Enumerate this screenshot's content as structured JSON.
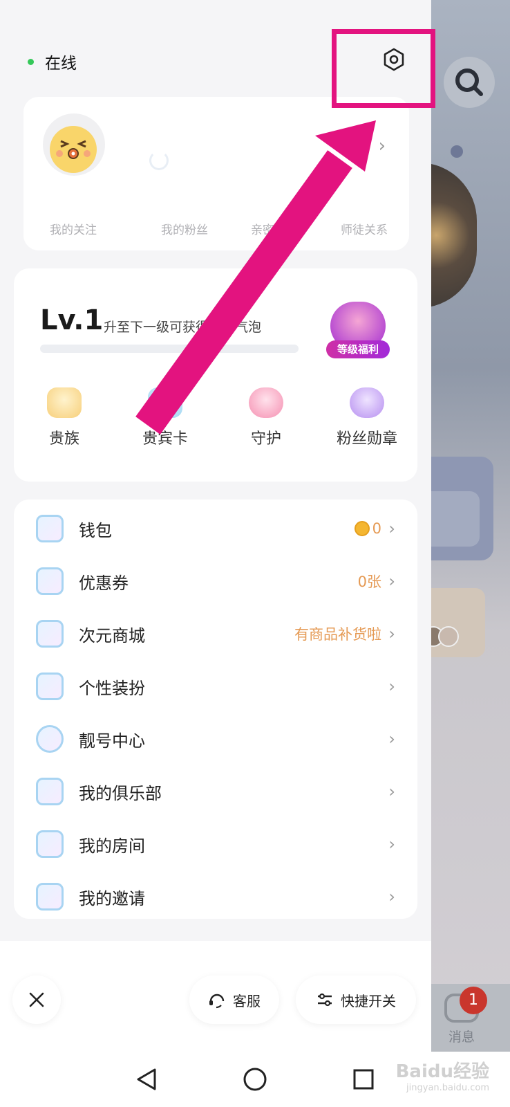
{
  "status": {
    "label": "在线",
    "dot_color": "#35c859"
  },
  "profile": {
    "stats": [
      {
        "label": "我的关注"
      },
      {
        "label": "我的粉丝"
      },
      {
        "label": "亲密关系"
      },
      {
        "label": "师徒关系"
      }
    ]
  },
  "level": {
    "badge": "Lv.1",
    "description": "升至下一级可获得专属气泡",
    "progress": 0,
    "gift_label": "等级福利"
  },
  "perks": [
    {
      "label": "贵族",
      "icon": "noble-icon",
      "color": "#f7cf7a"
    },
    {
      "label": "贵宾卡",
      "icon": "vip-card-icon",
      "color": "#9fd6f2"
    },
    {
      "label": "守护",
      "icon": "guard-icon",
      "color": "#f58fb1"
    },
    {
      "label": "粉丝勋章",
      "icon": "fan-medal-icon",
      "color": "#b68ef0"
    }
  ],
  "menu": [
    {
      "label": "钱包",
      "icon": "wallet-icon",
      "value": "0",
      "coin": true
    },
    {
      "label": "优惠券",
      "icon": "coupon-icon",
      "value": "0张"
    },
    {
      "label": "次元商城",
      "icon": "store-icon",
      "value": "有商品补货啦"
    },
    {
      "label": "个性装扮",
      "icon": "tshirt-icon",
      "value": ""
    },
    {
      "label": "靓号中心",
      "icon": "pretty-number-icon",
      "value": ""
    },
    {
      "label": "我的俱乐部",
      "icon": "club-icon",
      "value": ""
    },
    {
      "label": "我的房间",
      "icon": "home-icon",
      "value": ""
    },
    {
      "label": "我的邀请",
      "icon": "invite-icon",
      "value": ""
    }
  ],
  "bottom": {
    "customer_service": "客服",
    "quick_switch": "快捷开关"
  },
  "background_app": {
    "tab_message_label": "消息",
    "message_badge": "1"
  },
  "watermark": {
    "text": "Baidu经验",
    "sub": "jingyan.baidu.com"
  },
  "colors": {
    "accent": "#e3137f",
    "value_orange": "#e59a54"
  }
}
